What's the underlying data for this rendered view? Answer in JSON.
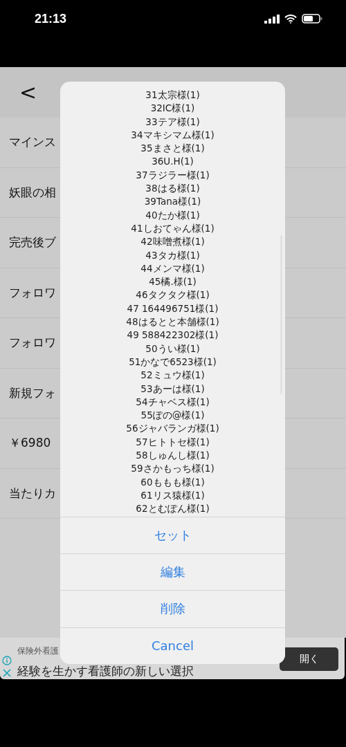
{
  "status_bar": {
    "time": "21:13"
  },
  "nav": {
    "back": "<"
  },
  "rows": [
    "マインス",
    "妖眼の相",
    "完売後ブ",
    "フォロワ",
    "フォロワ",
    "新規フォ",
    "￥6980",
    "当たりカ"
  ],
  "sheet": {
    "items": [
      "31太宗様(1)",
      "32IC様(1)",
      "33テア様(1)",
      "34マキシマム様(1)",
      "35まさと様(1)",
      "36U.H(1)",
      "37ラジラー様(1)",
      "38はる様(1)",
      "39Tana様(1)",
      "40たか様(1)",
      "41しおてゃん様(1)",
      "42味噌煮様(1)",
      "43タカ様(1)",
      "44メンマ様(1)",
      "45橘.様(1)",
      "46タクタク様(1)",
      "47 164496751様(1)",
      "48はるとと本舗様(1)",
      "49 588422302様(1)",
      "50うい様(1)",
      "51かなで6523様(1)",
      "52ミュウ様(1)",
      "53あーは様(1)",
      "54チャベス様(1)",
      "55ぽの@様(1)",
      "56ジャバランガ様(1)",
      "57ヒトトセ様(1)",
      "58しゅんし様(1)",
      "59さかもっち様(1)",
      "60ももも様(1)",
      "61リス猿様(1)",
      "62とむぽん様(1)"
    ],
    "actions": [
      "セット",
      "編集",
      "削除",
      "Cancel"
    ]
  },
  "ad": {
    "sponsor": "保険外看護",
    "headline": "経験を生かす看護師の新しい選択",
    "button": "開く"
  }
}
